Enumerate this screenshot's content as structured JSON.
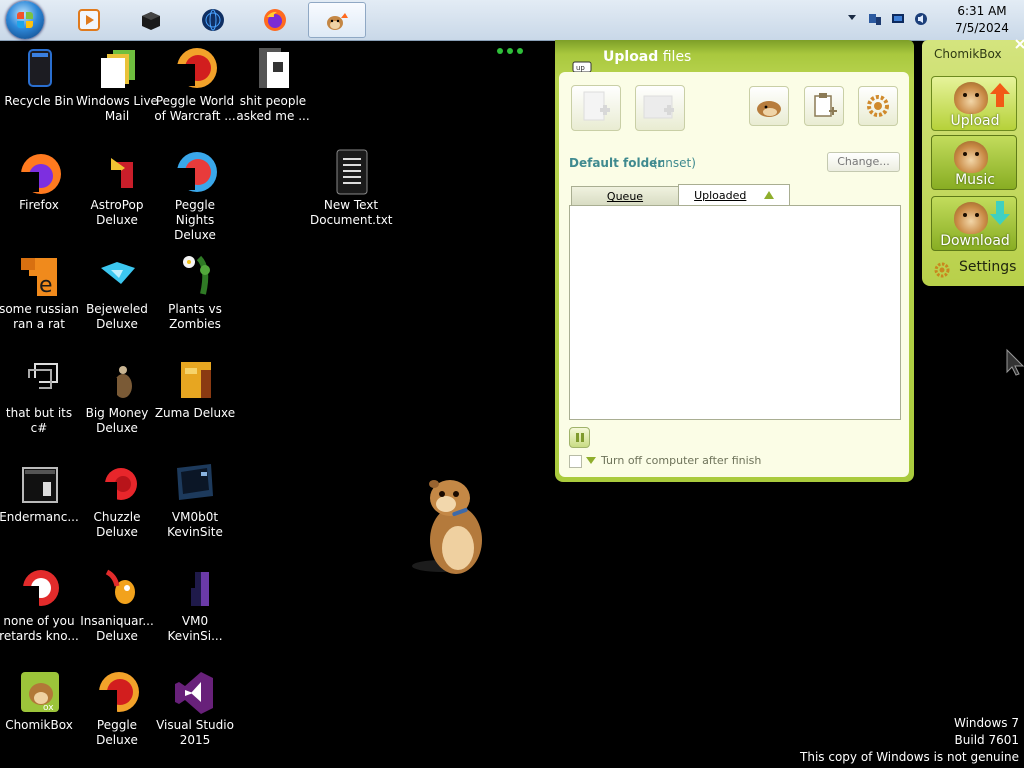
{
  "taskbar": {
    "start_label": "Start",
    "pinned": [
      "windows-media-player",
      "vm-box",
      "globe",
      "firefox",
      "chomikbox"
    ],
    "clock_time": "6:31 AM",
    "clock_date": "7/5/2024"
  },
  "desktop_icons": [
    {
      "label": "Recycle Bin",
      "icon": "recycle-bin-icon"
    },
    {
      "label": "Windows Live Mail",
      "icon": "mail-icon"
    },
    {
      "label": "Peggle World of Warcraft ...",
      "icon": "peggle-icon"
    },
    {
      "label": "shit people asked me ...",
      "icon": "folder-icon"
    },
    {
      "label": "Firefox",
      "icon": "firefox-icon"
    },
    {
      "label": "AstroPop Deluxe",
      "icon": "astropop-icon"
    },
    {
      "label": "Peggle Nights Deluxe",
      "icon": "peggle-nights-icon"
    },
    {
      "label": "New Text Document.txt",
      "icon": "text-file-icon"
    },
    {
      "label": "some russian ran a rat",
      "icon": "russian-app-icon"
    },
    {
      "label": "Bejeweled Deluxe",
      "icon": "bejeweled-icon"
    },
    {
      "label": "Plants vs Zombies",
      "icon": "pvz-icon"
    },
    {
      "label": "that but its c#",
      "icon": "shortcut-icon"
    },
    {
      "label": "Big Money Deluxe",
      "icon": "big-money-icon"
    },
    {
      "label": "Zuma Deluxe",
      "icon": "zuma-icon"
    },
    {
      "label": "Endermanc...",
      "icon": "window-app-icon"
    },
    {
      "label": "Chuzzle Deluxe",
      "icon": "chuzzle-icon"
    },
    {
      "label": "VM0b0t KevinSite",
      "icon": "vm-icon"
    },
    {
      "label": "none of you retards kno...",
      "icon": "red-ring-icon"
    },
    {
      "label": "Insaniquar... Deluxe",
      "icon": "insaniquarium-icon"
    },
    {
      "label": "VM0 KevinSi...",
      "icon": "vm2-icon"
    },
    {
      "label": "ChomikBox",
      "icon": "chomikbox-icon"
    },
    {
      "label": "Peggle Deluxe",
      "icon": "peggle-deluxe-icon"
    },
    {
      "label": "Visual Studio 2015",
      "icon": "visual-studio-icon"
    }
  ],
  "upload_window": {
    "title_bold": "Upload",
    "title_rest": " files",
    "default_folder_label": "Default folder",
    "default_folder_value": "(unset)",
    "change_button": "Change...",
    "tabs": [
      "Queue",
      "Uploaded"
    ],
    "active_tab": "Uploaded",
    "turn_off_label": "Turn off computer after finish",
    "turn_off_checked": false
  },
  "side_panel": {
    "title": "ChomikBox",
    "buttons": [
      "Upload",
      "Music",
      "Download"
    ],
    "active_button": "Upload",
    "settings_label": "Settings"
  },
  "watermark": {
    "line1": "Windows 7",
    "line2": "Build 7601",
    "line3": "This copy of Windows is not genuine"
  },
  "colors": {
    "accent_green": "#a9c83e",
    "folder_teal": "#3f8a8f",
    "desktop_bg": "#000000"
  }
}
